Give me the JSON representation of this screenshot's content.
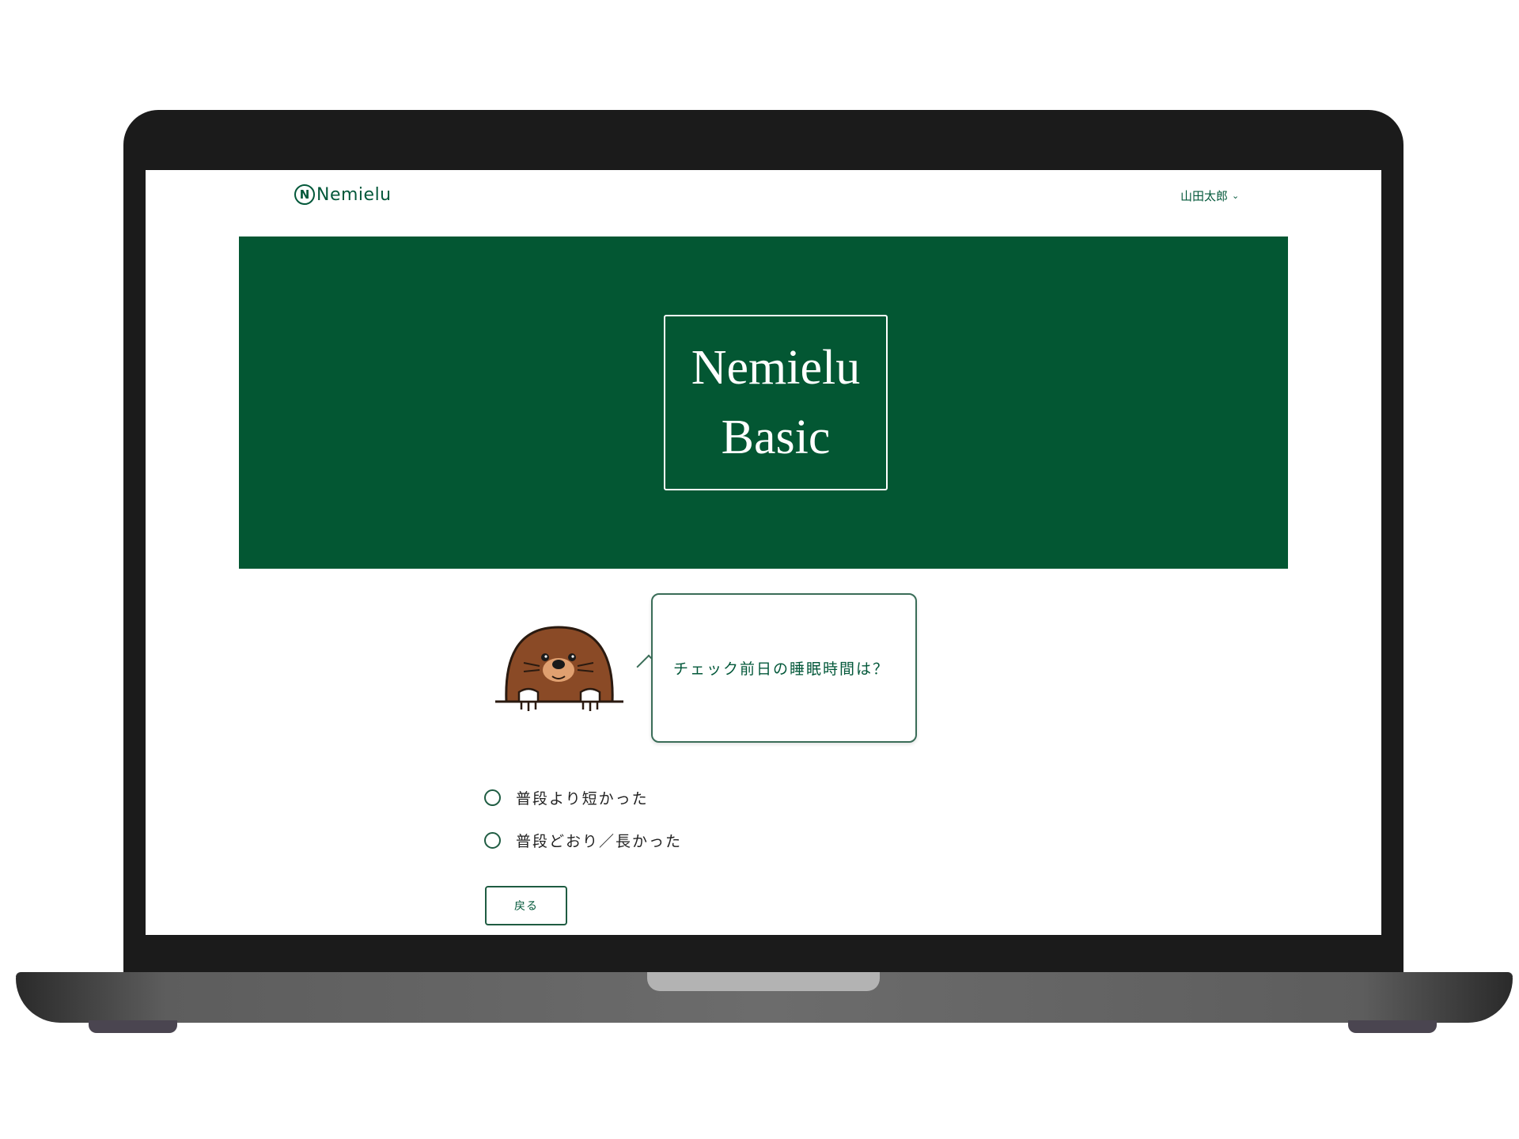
{
  "header": {
    "logo_icon_glyph": "N",
    "logo_text": "Nemielu",
    "user_name": "山田太郎",
    "user_menu_icon": "chevron-down-icon"
  },
  "hero": {
    "title_line1": "Nemielu",
    "title_line2": "Basic",
    "background_color": "#035733"
  },
  "question": {
    "text": "チェック前日の睡眠時間は？"
  },
  "options": [
    {
      "label": "普段より短かった"
    },
    {
      "label": "普段どおり／長かった"
    }
  ],
  "back_button_label": "戻る",
  "colors": {
    "accent": "#03583a"
  }
}
